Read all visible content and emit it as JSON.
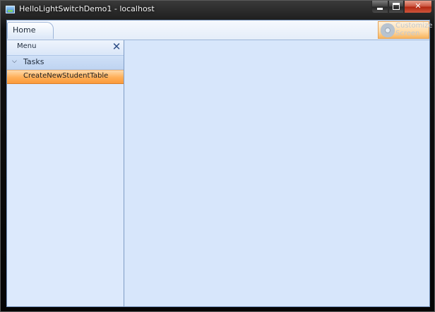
{
  "window": {
    "title": "HelloLightSwitchDemo1 - localhost",
    "controls": {
      "minimize": "",
      "maximize": "",
      "close": "✕"
    }
  },
  "tabs": [
    {
      "label": "Home",
      "selected": true
    }
  ],
  "customize": {
    "line1": "Customize",
    "line2": "Screen"
  },
  "menu": {
    "title": "Menu",
    "close_glyph": "✕",
    "groups": [
      {
        "label": "Tasks",
        "expanded_glyph": "⌄",
        "items": [
          {
            "label": "CreateNewStudentTable",
            "selected": true
          }
        ]
      }
    ]
  },
  "colors": {
    "client_bg": "#d7e6fb",
    "selected_item": "#ffae57",
    "accent": "#2d4d85"
  }
}
